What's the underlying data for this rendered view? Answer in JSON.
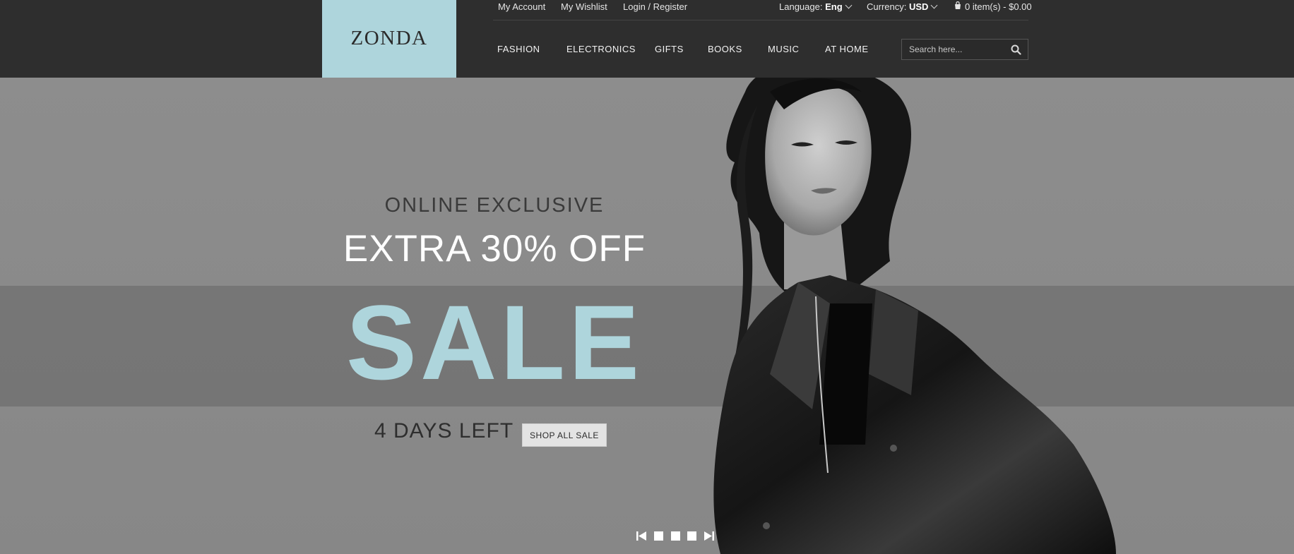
{
  "brand": {
    "name": "ZONDA",
    "accent_color": "#aed5dc"
  },
  "top_links": {
    "my_account": "My Account",
    "my_wishlist": "My Wishlist",
    "login_register": "Login / Register"
  },
  "settings": {
    "language_label": "Language:",
    "language_value": "Eng",
    "currency_label": "Currency:",
    "currency_value": "USD",
    "cart_summary": "0 item(s) - $0.00"
  },
  "nav": {
    "items": [
      "FASHION",
      "ELECTRONICS",
      "GIFTS",
      "BOOKS",
      "MUSIC",
      "AT HOME"
    ]
  },
  "search": {
    "placeholder": "Search here...",
    "icon": "search-icon"
  },
  "hero": {
    "pretitle": "ONLINE EXCLUSIVE",
    "offer": "EXTRA 30% OFF",
    "headline": "SALE",
    "countdown": "4 DAYS LEFT",
    "cta_label": "SHOP ALL SALE"
  },
  "slider": {
    "controls": [
      "prev-icon",
      "slide-dot",
      "slide-dot",
      "slide-dot",
      "next-icon"
    ],
    "slide_count": 3
  }
}
